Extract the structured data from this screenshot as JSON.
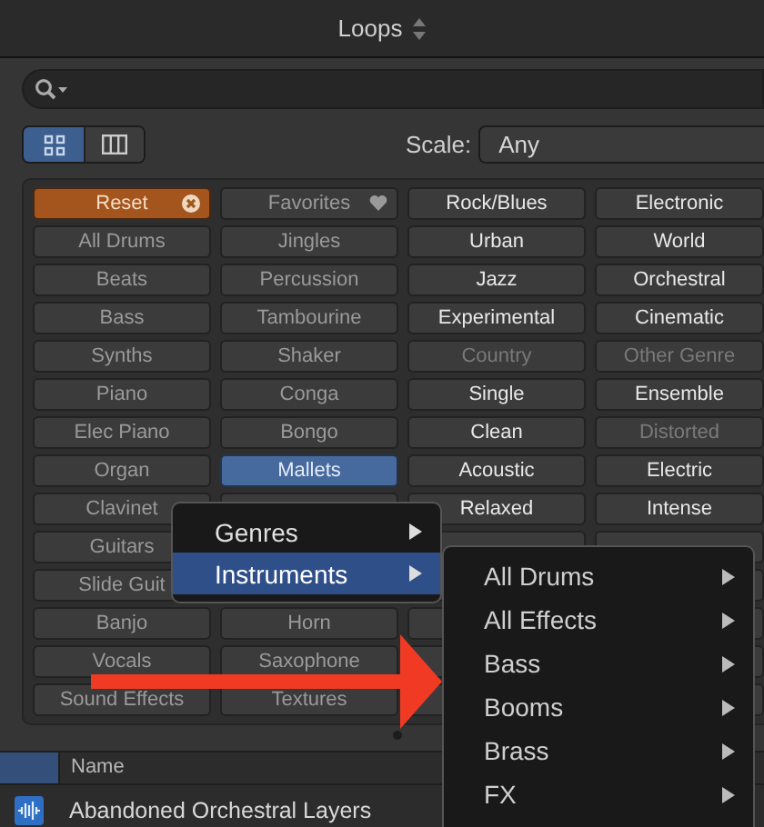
{
  "window": {
    "title": "Loops"
  },
  "view_modes": [
    {
      "kind": "grid",
      "selected": true
    },
    {
      "kind": "columns",
      "selected": false
    }
  ],
  "scale": {
    "label": "Scale:",
    "value": "Any"
  },
  "keyword_rows": [
    [
      {
        "kind": "reset",
        "label": "Reset",
        "selected": true,
        "disabled": false
      },
      {
        "kind": "favorites",
        "label": "Favorites",
        "selected": false,
        "disabled": true
      },
      {
        "label": "Rock/Blues",
        "selected": false,
        "disabled": false
      },
      {
        "label": "Electronic",
        "selected": false,
        "disabled": false
      }
    ],
    [
      {
        "label": "All Drums",
        "selected": false,
        "disabled": true
      },
      {
        "label": "Jingles",
        "selected": false,
        "disabled": true
      },
      {
        "label": "Urban",
        "selected": false,
        "disabled": false
      },
      {
        "label": "World",
        "selected": false,
        "disabled": false
      }
    ],
    [
      {
        "label": "Beats",
        "selected": false,
        "disabled": true
      },
      {
        "label": "Percussion",
        "selected": false,
        "disabled": true
      },
      {
        "label": "Jazz",
        "selected": false,
        "disabled": false
      },
      {
        "label": "Orchestral",
        "selected": false,
        "disabled": false
      }
    ],
    [
      {
        "label": "Bass",
        "selected": false,
        "disabled": true
      },
      {
        "label": "Tambourine",
        "selected": false,
        "disabled": true
      },
      {
        "label": "Experimental",
        "selected": false,
        "disabled": false
      },
      {
        "label": "Cinematic",
        "selected": false,
        "disabled": false
      }
    ],
    [
      {
        "label": "Synths",
        "selected": false,
        "disabled": true
      },
      {
        "label": "Shaker",
        "selected": false,
        "disabled": true
      },
      {
        "label": "Country",
        "selected": false,
        "disabled": true
      },
      {
        "label": "Other Genre",
        "selected": false,
        "disabled": true
      }
    ],
    [
      {
        "label": "Piano",
        "selected": false,
        "disabled": true
      },
      {
        "label": "Conga",
        "selected": false,
        "disabled": true
      },
      {
        "label": "Single",
        "selected": false,
        "disabled": false
      },
      {
        "label": "Ensemble",
        "selected": false,
        "disabled": false
      }
    ],
    [
      {
        "label": "Elec Piano",
        "selected": false,
        "disabled": true
      },
      {
        "label": "Bongo",
        "selected": false,
        "disabled": true
      },
      {
        "label": "Clean",
        "selected": false,
        "disabled": false
      },
      {
        "label": "Distorted",
        "selected": false,
        "disabled": true
      }
    ],
    [
      {
        "label": "Organ",
        "selected": false,
        "disabled": true
      },
      {
        "label": "Mallets",
        "selected": true,
        "disabled": false
      },
      {
        "label": "Acoustic",
        "selected": false,
        "disabled": false
      },
      {
        "label": "Electric",
        "selected": false,
        "disabled": false
      }
    ],
    [
      {
        "label": "Clavinet",
        "selected": false,
        "disabled": true
      },
      {
        "selected": false
      },
      {
        "label": "Relaxed",
        "selected": false,
        "disabled": false
      },
      {
        "label": "Intense",
        "selected": false,
        "disabled": false
      }
    ],
    [
      {
        "label": "Guitars",
        "selected": false,
        "disabled": true
      },
      null,
      {
        "selected": false
      },
      {
        "selected": false
      }
    ],
    [
      {
        "label": "Slide Guit",
        "selected": false,
        "disabled": true
      },
      null,
      {
        "selected": false
      },
      {
        "selected": false
      }
    ],
    [
      {
        "label": "Banjo",
        "selected": false,
        "disabled": true
      },
      {
        "label": "Horn",
        "selected": false,
        "disabled": true
      },
      {
        "selected": false
      },
      {
        "selected": false
      }
    ],
    [
      {
        "label": "Vocals",
        "selected": false,
        "disabled": true
      },
      {
        "label": "Saxophone",
        "selected": false,
        "disabled": true
      },
      {
        "selected": false
      },
      {
        "selected": false
      }
    ],
    [
      {
        "label": "Sound Effects",
        "selected": false,
        "disabled": true
      },
      {
        "label": "Textures",
        "selected": false,
        "disabled": true
      },
      {
        "selected": false
      },
      {
        "selected": false
      }
    ]
  ],
  "menu": {
    "items": [
      {
        "label": "Genres",
        "selected": false
      },
      {
        "label": "Instruments",
        "selected": true
      }
    ]
  },
  "submenu": {
    "items": [
      {
        "label": "All Drums",
        "selected": false
      },
      {
        "label": "All Effects",
        "selected": false
      },
      {
        "label": "Bass",
        "selected": false
      },
      {
        "label": "Booms",
        "selected": false
      },
      {
        "label": "Brass",
        "selected": false
      },
      {
        "label": "FX",
        "selected": false
      }
    ]
  },
  "list": {
    "columns": [
      "Name"
    ],
    "rows": [
      {
        "name": "Abandoned Orchestral Layers"
      }
    ]
  }
}
